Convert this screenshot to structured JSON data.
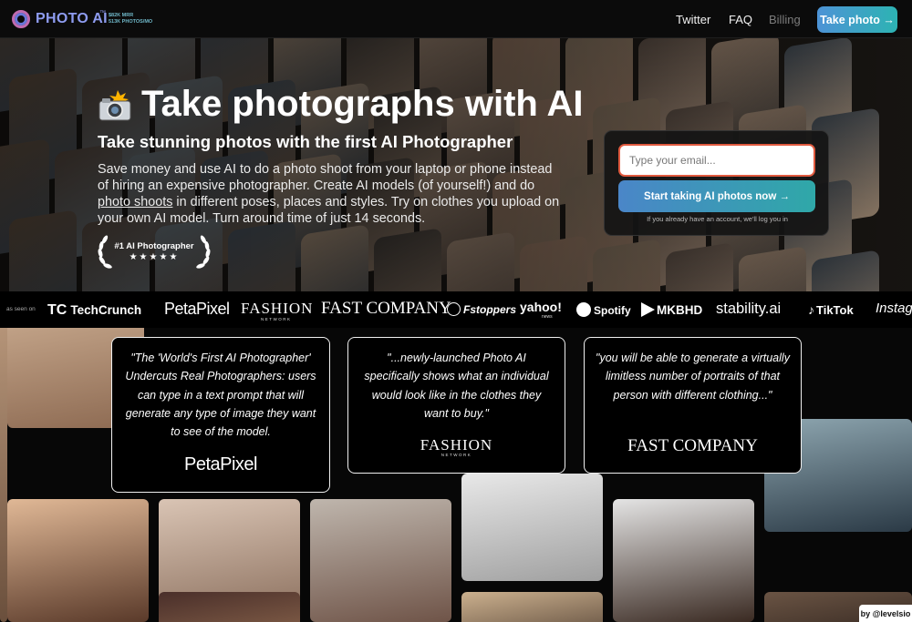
{
  "brand": {
    "name": "PHOTO AI",
    "tm": "™",
    "stats_line1": "$82K MRR",
    "stats_line2": "513K PHOTOS/MO",
    "logo_icon": "aperture-icon",
    "accent": "#8e9cf0"
  },
  "nav": {
    "links": [
      "Twitter",
      "FAQ",
      "Billing"
    ],
    "cta_label": "Take photo →"
  },
  "hero": {
    "title": "Take photographs with AI",
    "title_icon": "camera-flash-icon",
    "subtitle": "Take stunning photos with the first AI Photographer",
    "desc_part1": "Save money and use AI to do a photo shoot from your laptop or phone instead of hiring an expensive photographer. Create AI models (of yourself!) and do ",
    "desc_link": "photo shoots",
    "desc_part2": " in different poses, places and styles. Try on clothes you upload on your own AI model. Turn around time of just 14 seconds.",
    "badge_label": "#1 AI Photographer",
    "badge_stars": "★★★★★",
    "badge_rating": 5
  },
  "signup": {
    "email_placeholder": "Type your email...",
    "email_value": "",
    "button_label": "Start taking AI photos now →",
    "note": "If you already have an account, we'll log you in",
    "input_border": "#e05a3f",
    "button_gradient": [
      "#4a86c8",
      "#2fa8a8"
    ]
  },
  "press": {
    "as_seen_on": "as seen on",
    "logos": {
      "techcrunch": "TechCrunch",
      "petapixel": "PetaPixel",
      "fashion": "FASHION",
      "fashion_sub": "NETWORK",
      "fastcompany": "FAST COMPANY",
      "fstoppers": "Fstoppers",
      "yahoo": "yahoo!",
      "yahoo_sub": "news",
      "spotify": "Spotify",
      "mkbhd": "MKBHD",
      "stability": "stability.ai",
      "tiktok": "TikTok",
      "instagram": "Instag"
    }
  },
  "quotes": [
    {
      "text": "\"The 'World's First AI Photographer' Undercuts Real Photographers: users can type in a text prompt that will generate any type of image they want to see of the model.",
      "source": "PetaPixel"
    },
    {
      "text": "\"...newly-launched Photo AI specifically shows what an individual would look like in the clothes they want to buy.\"",
      "source": "FASHION",
      "source_sub": "NETWORK"
    },
    {
      "text": "\"you will be able to generate a virtually limitless number of portraits of that person with different clothing...\"",
      "source": "FAST COMPANY"
    }
  ],
  "credit": "by @levelsio"
}
